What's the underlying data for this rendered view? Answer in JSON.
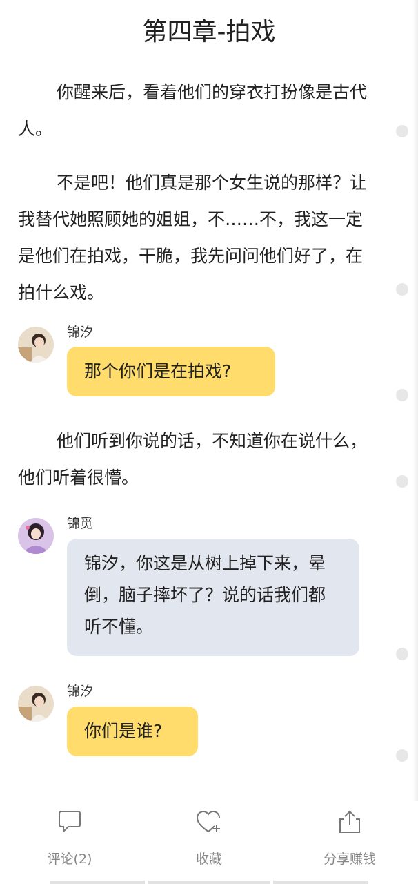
{
  "chapter": {
    "title": "第四章-拍戏"
  },
  "paragraphs": [
    "你醒来后，看着他们的穿衣打扮像是古代人。",
    "不是吧！他们真是那个女生说的那样？让我替代她照顾她的姐姐，不……不，我这一定是他们在拍戏，干脆，我先问问他们好了，在拍什么戏。",
    "他们听到你说的话，不知道你在说什么，他们听着很懵。"
  ],
  "messages": [
    {
      "speaker": "锦汐",
      "text": "那个你们是在拍戏?",
      "bubble_color": "#ffdc6b",
      "avatar_icon": "avatar-jinxi"
    },
    {
      "speaker": "锦觅",
      "text": "锦汐，你这是从树上掉下来，晕倒，脑子摔坏了？说的话我们都听不懂。",
      "bubble_color": "#e2e6ee",
      "avatar_icon": "avatar-jinmi"
    },
    {
      "speaker": "锦汐",
      "text": "你们是谁?",
      "bubble_color": "#ffdc6b",
      "avatar_icon": "avatar-jinxi"
    }
  ],
  "actions": {
    "comment_label": "评论(2)",
    "favorite_label": "收藏",
    "share_label": "分享赚钱",
    "comment_icon": "comment-bubble-icon",
    "favorite_icon": "heart-plus-icon",
    "share_icon": "share-upload-icon"
  },
  "colors": {
    "yellow_bubble": "#ffdc6b",
    "blue_bubble": "#e2e6ee",
    "label_gray": "#888888"
  }
}
